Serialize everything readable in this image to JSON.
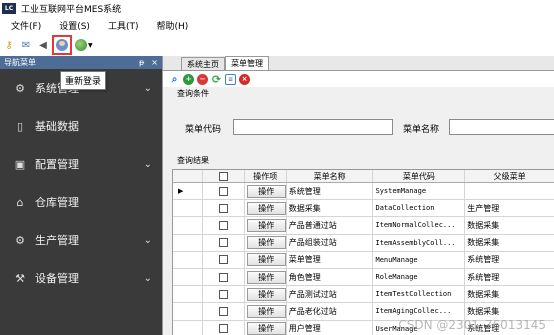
{
  "window": {
    "app_icon_text": "LC",
    "title": "工业互联网平台MES系统"
  },
  "menu": [
    "文件(F)",
    "设置(S)",
    "工具(T)",
    "帮助(H)"
  ],
  "toolbar": {
    "icons": [
      "key-icon",
      "mail-icon",
      "speaker-icon",
      "user-login-icon",
      "globe-icon"
    ],
    "tooltip": "重新登录",
    "highlight_color": "#e53935"
  },
  "nav": {
    "title": "导航菜单",
    "pin": "ᵽ",
    "close": "×",
    "items": [
      {
        "label": "系统管理",
        "icon": "gear-icon",
        "glyph": "⚙",
        "chevron": "⌄"
      },
      {
        "label": "基础数据",
        "icon": "database-icon",
        "glyph": "▯",
        "chevron": ""
      },
      {
        "label": "配置管理",
        "icon": "config-icon",
        "glyph": "▣",
        "chevron": "⌄"
      },
      {
        "label": "仓库管理",
        "icon": "warehouse-icon",
        "glyph": "⌂",
        "chevron": ""
      },
      {
        "label": "生产管理",
        "icon": "production-icon",
        "glyph": "⚙",
        "chevron": "⌄"
      },
      {
        "label": "设备管理",
        "icon": "wrench-icon",
        "glyph": "⚒",
        "chevron": "⌄"
      }
    ],
    "bg_color": "#3a3a3a",
    "header_color": "#4d6d96"
  },
  "tabs": [
    {
      "label": "系统主页",
      "active": false
    },
    {
      "label": "菜单管理",
      "active": true
    }
  ],
  "actions": [
    "search-icon",
    "add-icon",
    "delete-icon",
    "refresh-icon",
    "document-icon",
    "close-icon"
  ],
  "query": {
    "section_title": "查询条件",
    "menu_code_label": "菜单代码",
    "menu_code_value": "",
    "menu_name_label": "菜单名称",
    "menu_name_value": ""
  },
  "results": {
    "section_title": "查询结果",
    "columns": [
      "",
      "",
      "操作项",
      "菜单名称",
      "菜单代码",
      "父级菜单"
    ],
    "op_label": "操作",
    "rows": [
      {
        "name": "系统管理",
        "code": "SystemManage",
        "parent": "",
        "current": true
      },
      {
        "name": "数据采集",
        "code": "DataCollection",
        "parent": "生产管理",
        "current": false
      },
      {
        "name": "产品普通过站",
        "code": "ItemNormalCollec...",
        "parent": "数据采集",
        "current": false
      },
      {
        "name": "产品组装过站",
        "code": "ItemAssemblyColl...",
        "parent": "数据采集",
        "current": false
      },
      {
        "name": "菜单管理",
        "code": "MenuManage",
        "parent": "系统管理",
        "current": false
      },
      {
        "name": "角色管理",
        "code": "RoleManage",
        "parent": "系统管理",
        "current": false
      },
      {
        "name": "产品测试过站",
        "code": "ItemTestCollection",
        "parent": "数据采集",
        "current": false
      },
      {
        "name": "产品老化过站",
        "code": "ItemAgingCollec...",
        "parent": "数据采集",
        "current": false
      },
      {
        "name": "用户管理",
        "code": "UserManage",
        "parent": "系统管理",
        "current": false
      }
    ]
  },
  "watermark": "CSDN @2301_76013145"
}
